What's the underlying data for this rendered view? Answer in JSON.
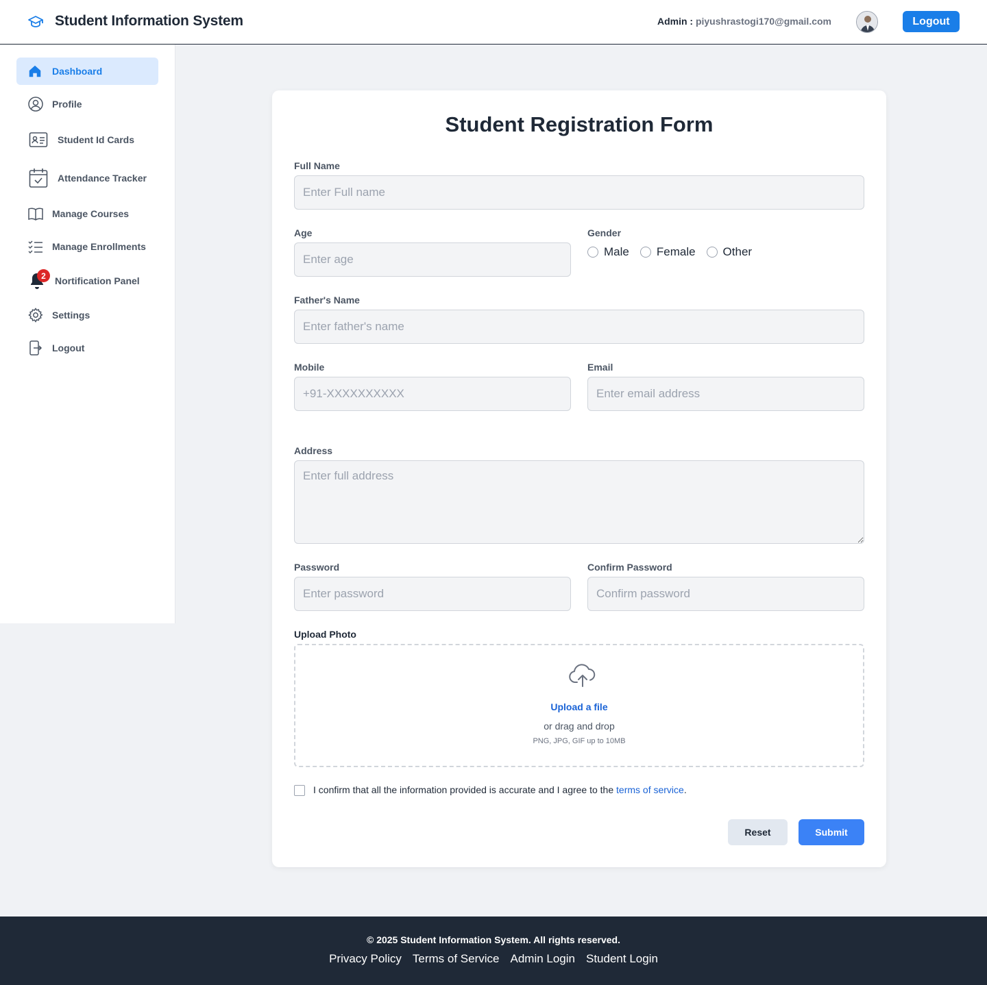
{
  "header": {
    "brand_icon": "graduation-cap-icon",
    "title": "Student Information System",
    "admin_prefix": "Admin : ",
    "admin_email": "piyushrastogi170@gmail.com",
    "logout_label": "Logout"
  },
  "sidebar": {
    "items": [
      {
        "label": "Dashboard",
        "icon": "home-icon"
      },
      {
        "label": "Profile",
        "icon": "user-circle-icon"
      },
      {
        "label": "Student Id Cards",
        "icon": "id-card-icon"
      },
      {
        "label": "Attendance Tracker",
        "icon": "calendar-check-icon"
      },
      {
        "label": "Manage Courses",
        "icon": "book-open-icon"
      },
      {
        "label": "Manage Enrollments",
        "icon": "checklist-icon"
      },
      {
        "label": "Nortification Panel",
        "icon": "bell-icon",
        "badge": "2"
      },
      {
        "label": "Settings",
        "icon": "gear-icon"
      },
      {
        "label": "Logout",
        "icon": "logout-icon"
      }
    ]
  },
  "form": {
    "title": "Student Registration Form",
    "full_name": {
      "label": "Full Name",
      "placeholder": "Enter Full name"
    },
    "age": {
      "label": "Age",
      "placeholder": "Enter age"
    },
    "gender": {
      "label": "Gender",
      "options": [
        "Male",
        "Female",
        "Other"
      ]
    },
    "father_name": {
      "label": "Father's Name",
      "placeholder": "Enter father's name"
    },
    "mobile": {
      "label": "Mobile",
      "placeholder": "+91-XXXXXXXXXX"
    },
    "email": {
      "label": "Email",
      "placeholder": "Enter email address"
    },
    "address": {
      "label": "Address",
      "placeholder": "Enter full address"
    },
    "password": {
      "label": "Password",
      "placeholder": "Enter password"
    },
    "confirm_password": {
      "label": "Confirm Password",
      "placeholder": "Confirm password"
    },
    "upload": {
      "label": "Upload Photo",
      "link": "Upload a file",
      "drag": "or drag and drop",
      "hint": "PNG, JPG, GIF up to 10MB",
      "icon": "cloud-upload-icon"
    },
    "confirm": {
      "text": "I confirm that all the information provided is accurate and I agree to the ",
      "link": "terms of service",
      "end": "."
    },
    "reset_label": "Reset",
    "submit_label": "Submit"
  },
  "footer": {
    "copyright": "© 2025 Student Information System. All rights reserved.",
    "links": [
      "Privacy Policy",
      "Terms of Service",
      "Admin Login",
      "Student Login"
    ]
  },
  "colors": {
    "accent": "#1a7ee8",
    "submit": "#3b82f6",
    "footer_bg": "#1f2937",
    "badge": "#dc2626"
  }
}
